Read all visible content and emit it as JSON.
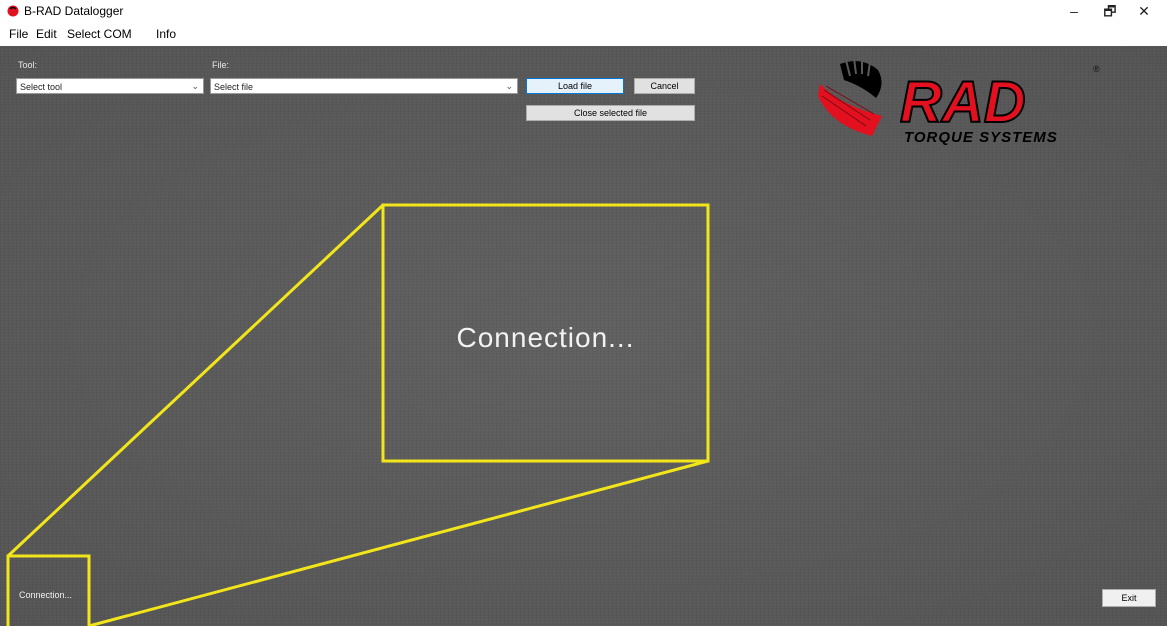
{
  "window": {
    "title": "B-RAD Datalogger",
    "controls": {
      "minimize": "–",
      "maximize": "🗗",
      "close": "✕"
    }
  },
  "menu": {
    "file": "File",
    "edit": "Edit",
    "select_com": "Select COM",
    "info": "Info"
  },
  "toolbar": {
    "tool_label": "Tool:",
    "tool_select_value": "Select tool",
    "file_label": "File:",
    "file_select_value": "Select file",
    "load_button": "Load file",
    "cancel_button": "Cancel",
    "close_selected_button": "Close selected file",
    "chevron": "⌄"
  },
  "logo": {
    "brand": "RAD",
    "tagline": "TORQUE SYSTEMS",
    "registered": "®",
    "colors": {
      "red": "#e3101f",
      "black": "#000000"
    }
  },
  "status": {
    "text": "Connection...",
    "zoom_text": "Connection..."
  },
  "footer": {
    "exit_button": "Exit"
  },
  "colors": {
    "background": "#5a5a5a",
    "zoom_highlight": "#f2e51a",
    "focus_blue": "#0078d7"
  }
}
